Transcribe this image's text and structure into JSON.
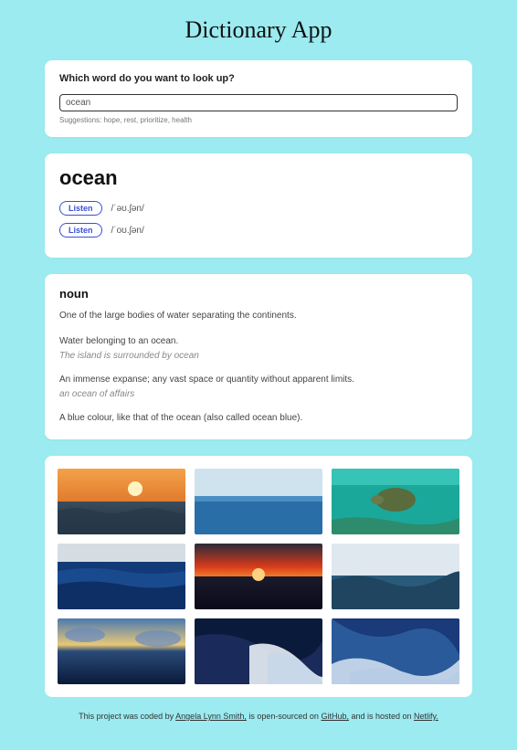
{
  "title": "Dictionary App",
  "search": {
    "prompt": "Which word do you want to look up?",
    "value": "ocean",
    "suggestions": "Suggestions: hope, rest, prioritize, health"
  },
  "result": {
    "word": "ocean",
    "phonetics": [
      {
        "listen": "Listen",
        "text": "/ˈəʊ.ʃən/"
      },
      {
        "listen": "Listen",
        "text": "/ˈoʊ.ʃən/"
      }
    ]
  },
  "meanings": {
    "part_of_speech": "noun",
    "definitions": [
      {
        "text": "One of the large bodies of water separating the continents.",
        "example": null
      },
      {
        "text": "Water belonging to an ocean.",
        "example": "The island is surrounded by ocean"
      },
      {
        "text": "An immense expanse; any vast space or quantity without apparent limits.",
        "example": "an ocean of affairs"
      },
      {
        "text": "A blue colour, like that of the ocean (also called ocean blue).",
        "example": null
      }
    ]
  },
  "footer": {
    "pre": "This project was coded by ",
    "author": "Angela Lynn Smith,",
    "mid": " is open-sourced on ",
    "github": "GitHub,",
    "post": " and is hosted on ",
    "host": "Netlify."
  }
}
